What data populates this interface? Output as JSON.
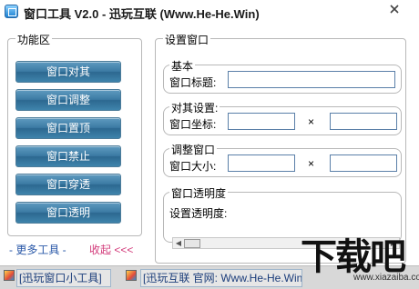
{
  "window": {
    "title": "窗口工具 V2.0 - 迅玩互联 (Www.He-He.Win)",
    "close_icon": "close-icon"
  },
  "functions": {
    "legend": "功能区",
    "buttons": [
      "窗口对其",
      "窗口调整",
      "窗口置顶",
      "窗口禁止",
      "窗口穿透",
      "窗口透明"
    ]
  },
  "links": {
    "more": "- 更多工具 -",
    "fold": "收起 <<<"
  },
  "settings": {
    "legend": "设置窗口",
    "basic": {
      "legend": "基本",
      "title_label": "窗口标题:",
      "title_value": ""
    },
    "align": {
      "legend": "对其设置:",
      "coord_label": "窗口坐标:",
      "x_value": "",
      "y_value": "",
      "times": "×"
    },
    "resize": {
      "legend": "调整窗口",
      "size_label": "窗口大小:",
      "w_value": "",
      "h_value": "",
      "times": "×"
    },
    "opacity": {
      "legend": "窗口透明度",
      "label": "设置透明度:",
      "level": 0
    }
  },
  "status": {
    "left": "[迅玩窗口小工具]",
    "right": "[迅玩互联 官网: Www.He-He.Win]"
  },
  "watermark": {
    "text": "下载吧",
    "url": "www.xiazaiba.com"
  }
}
